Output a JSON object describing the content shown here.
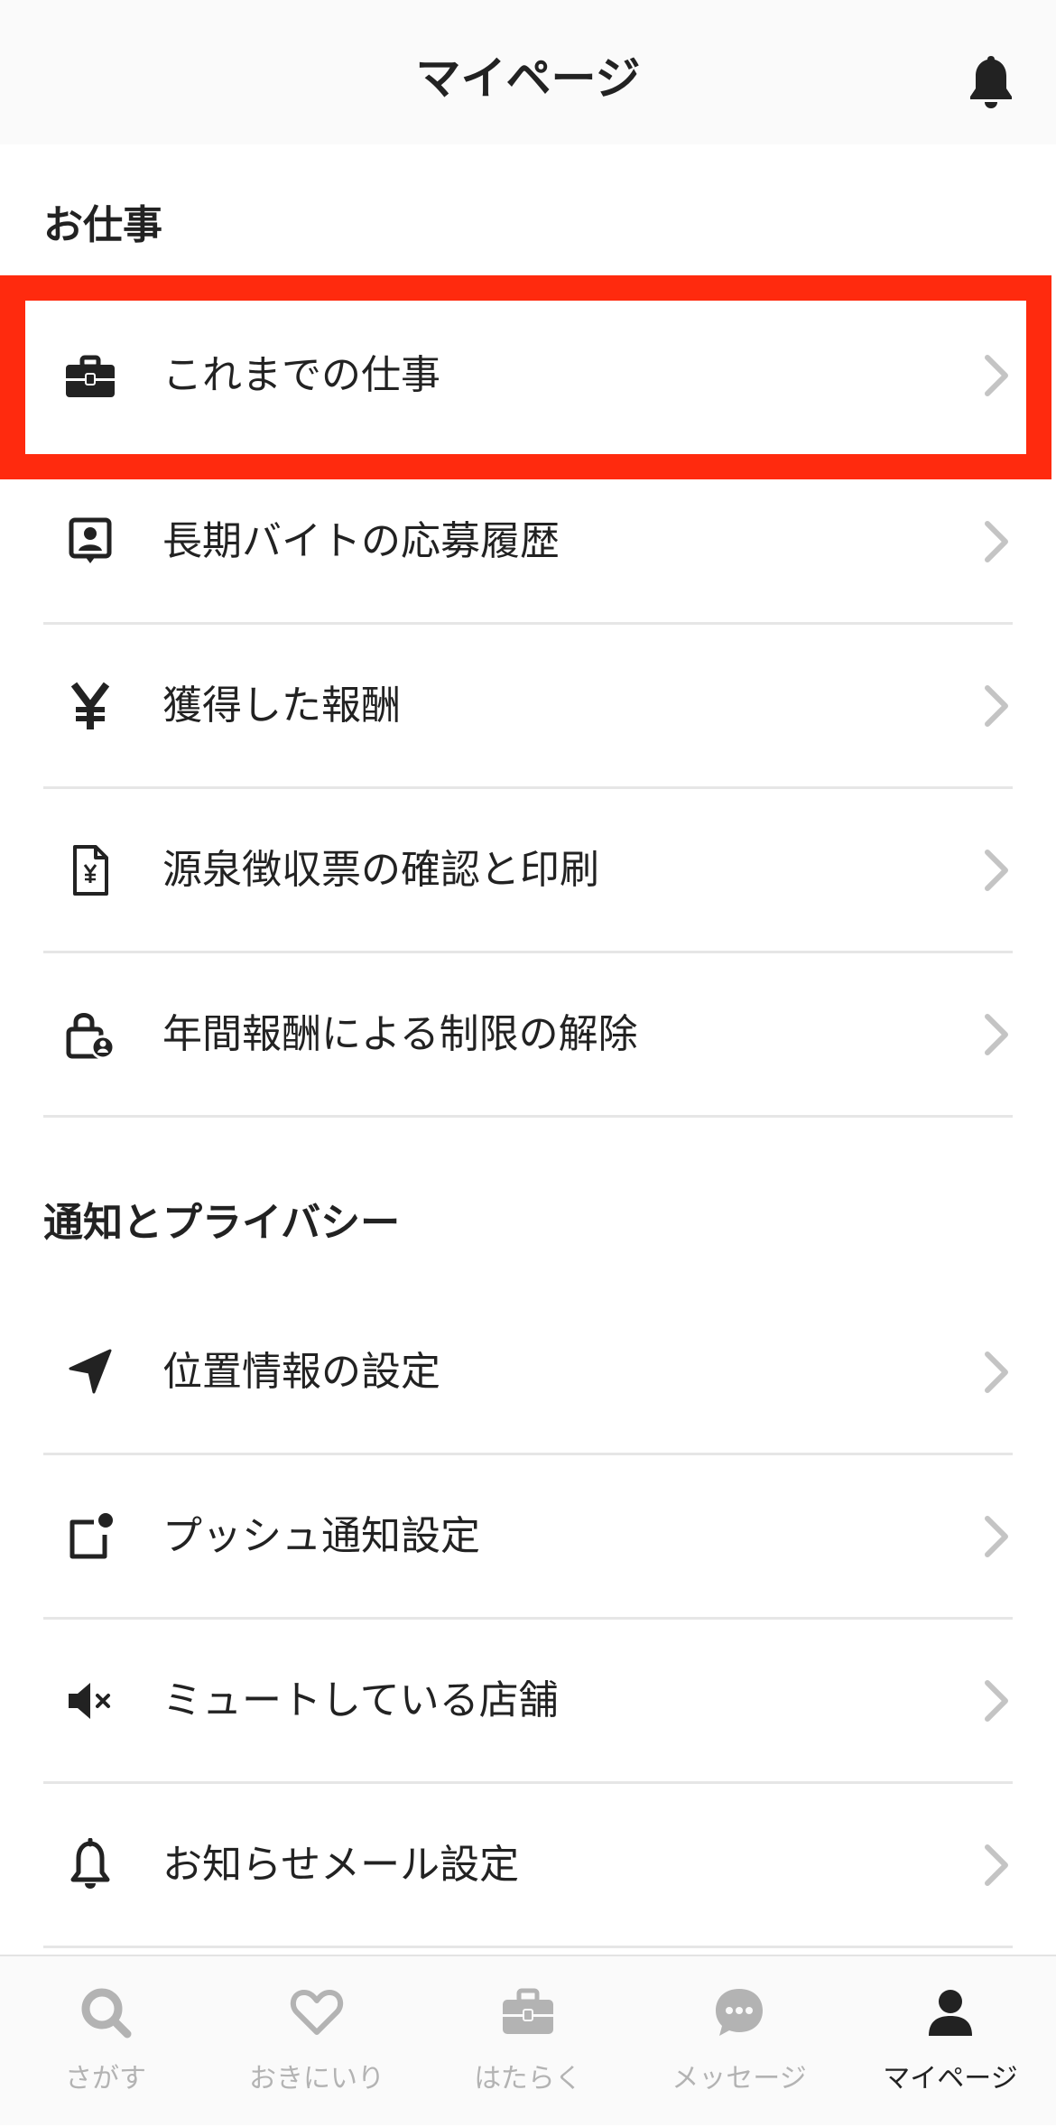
{
  "header": {
    "title": "マイページ",
    "bell_icon": "bell-icon"
  },
  "sections": {
    "work": {
      "title": "お仕事",
      "items": [
        {
          "label": "これまでの仕事",
          "icon": "briefcase-icon"
        },
        {
          "label": "長期バイトの応募履歴",
          "icon": "id-badge-icon"
        },
        {
          "label": "獲得した報酬",
          "icon": "yen-icon"
        },
        {
          "label": "源泉徴収票の確認と印刷",
          "icon": "yen-document-icon"
        },
        {
          "label": "年間報酬による制限の解除",
          "icon": "unlock-icon"
        }
      ]
    },
    "privacy": {
      "title": "通知とプライバシー",
      "items": [
        {
          "label": "位置情報の設定",
          "icon": "location-arrow-icon"
        },
        {
          "label": "プッシュ通知設定",
          "icon": "push-notification-icon"
        },
        {
          "label": "ミュートしている店舗",
          "icon": "mute-icon"
        },
        {
          "label": "お知らせメール設定",
          "icon": "bell-icon"
        }
      ]
    }
  },
  "tabbar": {
    "active_tab": "mypage",
    "tabs": [
      {
        "label": "さがす",
        "icon": "search-icon"
      },
      {
        "label": "おきにいり",
        "icon": "heart-icon"
      },
      {
        "label": "はたらく",
        "icon": "briefcase-icon"
      },
      {
        "label": "メッセージ",
        "icon": "chat-bubble-icon"
      },
      {
        "label": "マイページ",
        "icon": "person-icon"
      }
    ]
  },
  "colors": {
    "highlight": "#ff2a0e",
    "text": "#222222",
    "inactive_tab": "#b3b3b3",
    "chevron": "#c4c4c4",
    "divider": "#e6e6e6"
  }
}
